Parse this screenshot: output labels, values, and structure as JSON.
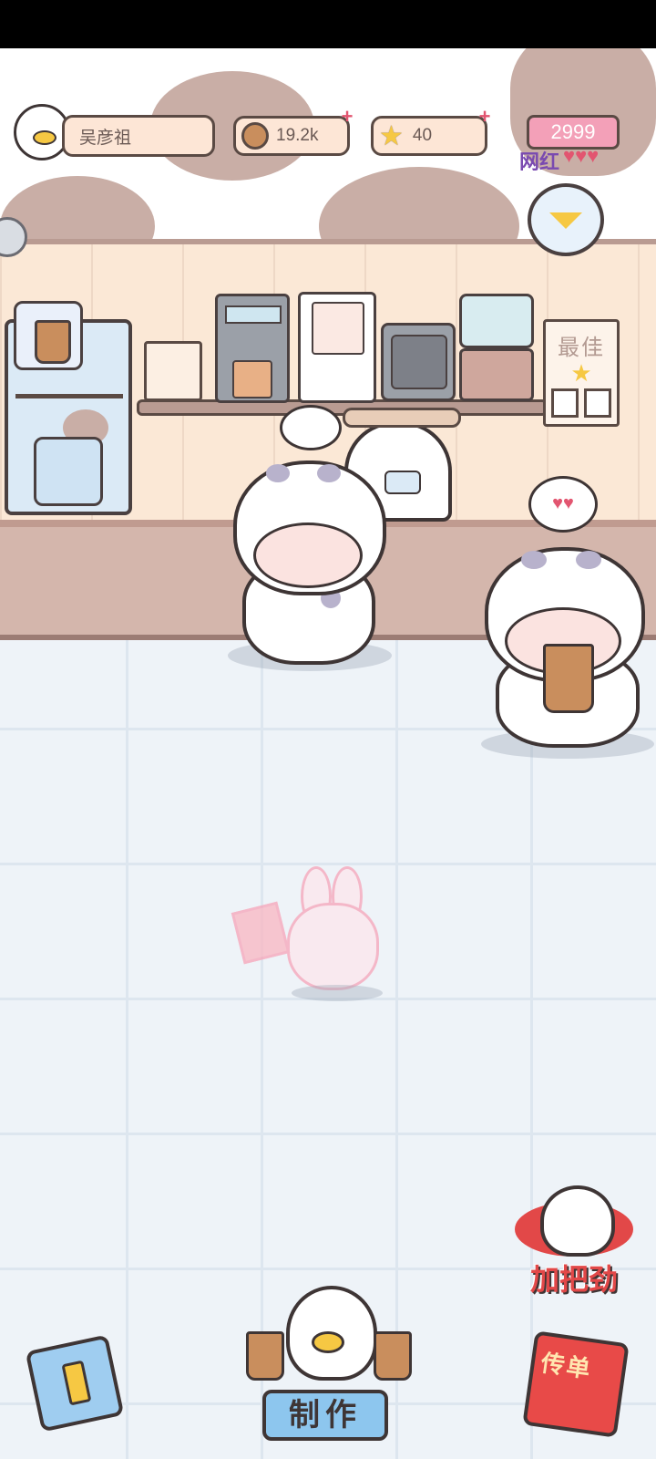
{
  "hud": {
    "player_name": "吴彦祖",
    "currency_amount": "19.2k",
    "stars_amount": "40",
    "popularity_value": "2999",
    "popularity_label": "网红"
  },
  "shop": {
    "best_board_label": "最佳"
  },
  "actions": {
    "cheer_label": "加把劲",
    "make_label": "制作",
    "flyers_label": "传单"
  },
  "colors": {
    "accent_pink": "#e25570",
    "cloud_brown": "#c9aea6",
    "counter_brown": "#d4b6ac",
    "floor_tile": "#eef3f8",
    "make_button_blue": "#8dc6ee"
  },
  "icons": {
    "avatar": "duck-avatar-icon",
    "currency": "bubble-tea-coin-icon",
    "stars": "star-icon",
    "menu": "chevron-down-icon",
    "guide": "guide-book-icon",
    "flyers": "flyer-box-icon"
  }
}
